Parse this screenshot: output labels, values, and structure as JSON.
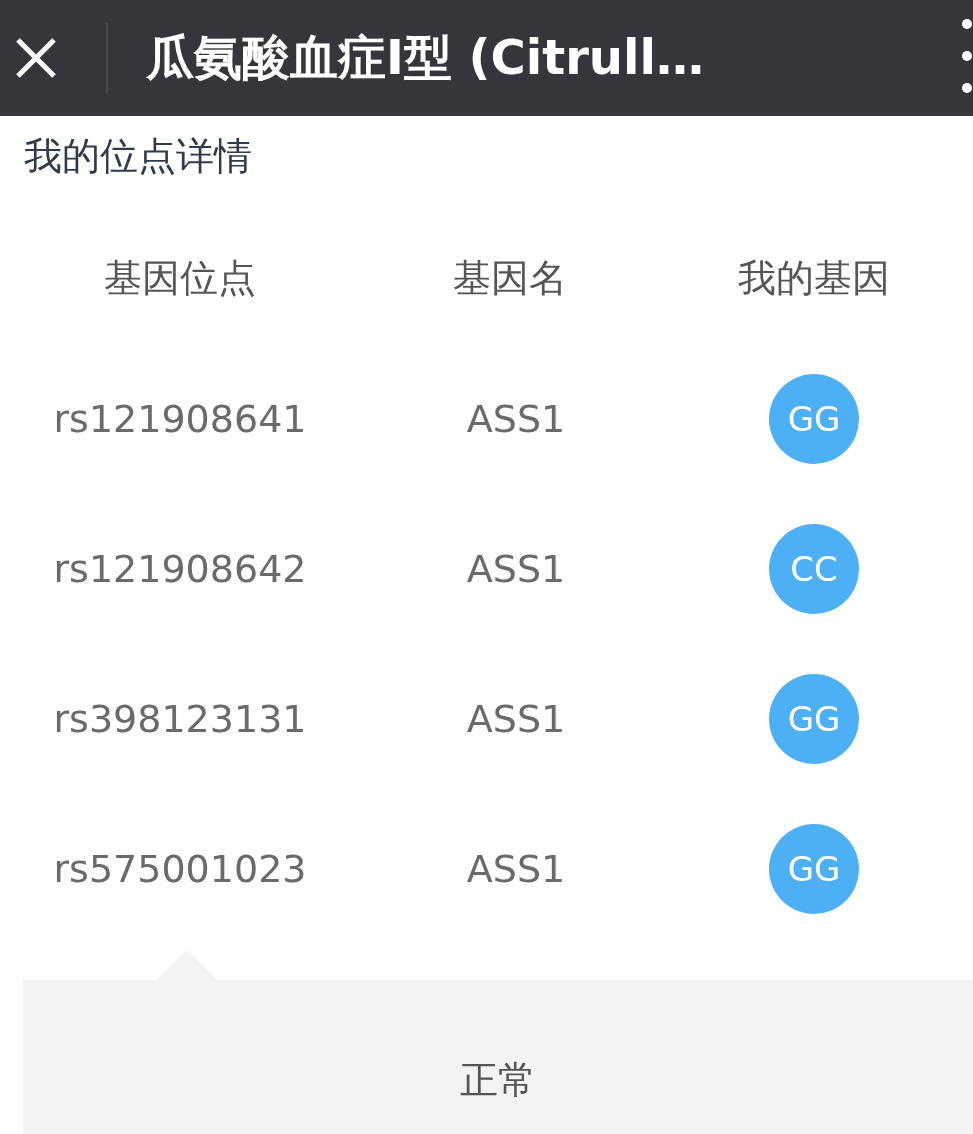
{
  "app_bar": {
    "title": "瓜氨酸血症I型 (Citrull…"
  },
  "section_title": "我的位点详情",
  "table": {
    "columns": [
      "基因位点",
      "基因名",
      "我的基因"
    ],
    "rows": [
      {
        "locus": "rs121908641",
        "gene": "ASS1",
        "genotype": "GG"
      },
      {
        "locus": "rs121908642",
        "gene": "ASS1",
        "genotype": "CC"
      },
      {
        "locus": "rs398123131",
        "gene": "ASS1",
        "genotype": "GG"
      },
      {
        "locus": "rs575001023",
        "gene": "ASS1",
        "genotype": "GG"
      }
    ]
  },
  "result": {
    "text": "正常"
  }
}
